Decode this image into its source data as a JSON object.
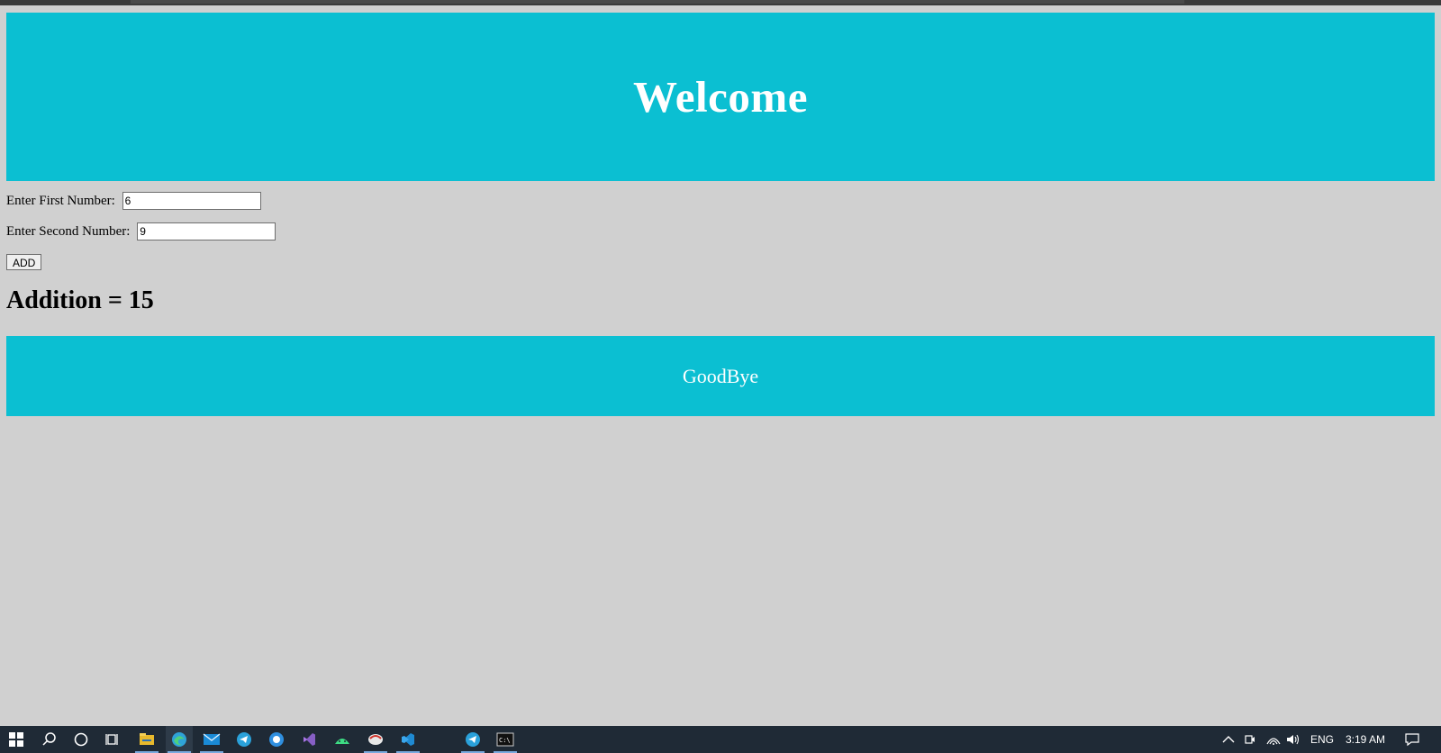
{
  "header": {
    "title": "Welcome"
  },
  "form": {
    "first_label": "Enter First Number: ",
    "first_value": "6",
    "second_label": "Enter Second Number: ",
    "second_value": "9",
    "add_label": "ADD"
  },
  "result": {
    "text": "Addition = 15"
  },
  "footer": {
    "text": "GoodBye"
  },
  "taskbar": {
    "icons": [
      "windows-start-icon",
      "search-icon",
      "cortana-icon",
      "task-view-icon",
      "file-explorer-icon",
      "edge-icon",
      "mail-icon",
      "telegram-icon",
      "browser-icon",
      "visual-studio-icon",
      "android-studio-icon",
      "app-icon",
      "vscode-icon",
      "telegram-icon",
      "terminal-icon"
    ],
    "lang": "ENG",
    "time": "3:19 AM"
  },
  "colors": {
    "accent": "#0bbfd2",
    "background": "#d0d0d0",
    "taskbar": "#1f2a36"
  }
}
